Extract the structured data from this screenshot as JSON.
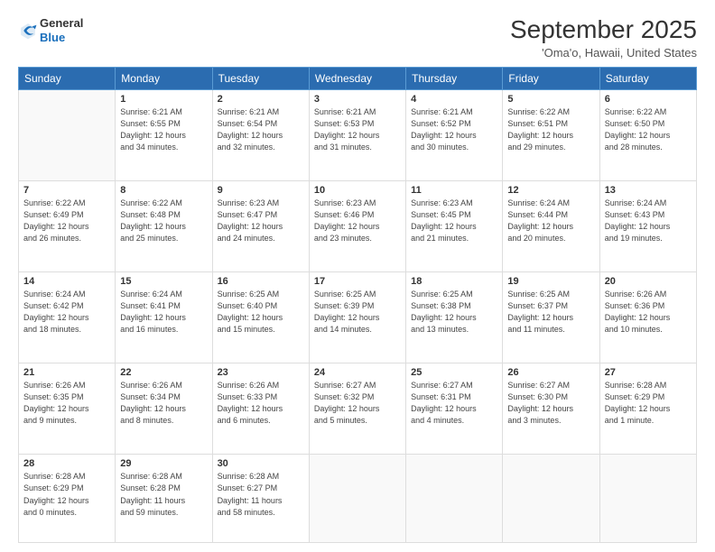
{
  "logo": {
    "general": "General",
    "blue": "Blue"
  },
  "header": {
    "month": "September 2025",
    "location": "'Oma'o, Hawaii, United States"
  },
  "weekdays": [
    "Sunday",
    "Monday",
    "Tuesday",
    "Wednesday",
    "Thursday",
    "Friday",
    "Saturday"
  ],
  "weeks": [
    [
      {
        "day": "",
        "info": ""
      },
      {
        "day": "1",
        "info": "Sunrise: 6:21 AM\nSunset: 6:55 PM\nDaylight: 12 hours\nand 34 minutes."
      },
      {
        "day": "2",
        "info": "Sunrise: 6:21 AM\nSunset: 6:54 PM\nDaylight: 12 hours\nand 32 minutes."
      },
      {
        "day": "3",
        "info": "Sunrise: 6:21 AM\nSunset: 6:53 PM\nDaylight: 12 hours\nand 31 minutes."
      },
      {
        "day": "4",
        "info": "Sunrise: 6:21 AM\nSunset: 6:52 PM\nDaylight: 12 hours\nand 30 minutes."
      },
      {
        "day": "5",
        "info": "Sunrise: 6:22 AM\nSunset: 6:51 PM\nDaylight: 12 hours\nand 29 minutes."
      },
      {
        "day": "6",
        "info": "Sunrise: 6:22 AM\nSunset: 6:50 PM\nDaylight: 12 hours\nand 28 minutes."
      }
    ],
    [
      {
        "day": "7",
        "info": "Sunrise: 6:22 AM\nSunset: 6:49 PM\nDaylight: 12 hours\nand 26 minutes."
      },
      {
        "day": "8",
        "info": "Sunrise: 6:22 AM\nSunset: 6:48 PM\nDaylight: 12 hours\nand 25 minutes."
      },
      {
        "day": "9",
        "info": "Sunrise: 6:23 AM\nSunset: 6:47 PM\nDaylight: 12 hours\nand 24 minutes."
      },
      {
        "day": "10",
        "info": "Sunrise: 6:23 AM\nSunset: 6:46 PM\nDaylight: 12 hours\nand 23 minutes."
      },
      {
        "day": "11",
        "info": "Sunrise: 6:23 AM\nSunset: 6:45 PM\nDaylight: 12 hours\nand 21 minutes."
      },
      {
        "day": "12",
        "info": "Sunrise: 6:24 AM\nSunset: 6:44 PM\nDaylight: 12 hours\nand 20 minutes."
      },
      {
        "day": "13",
        "info": "Sunrise: 6:24 AM\nSunset: 6:43 PM\nDaylight: 12 hours\nand 19 minutes."
      }
    ],
    [
      {
        "day": "14",
        "info": "Sunrise: 6:24 AM\nSunset: 6:42 PM\nDaylight: 12 hours\nand 18 minutes."
      },
      {
        "day": "15",
        "info": "Sunrise: 6:24 AM\nSunset: 6:41 PM\nDaylight: 12 hours\nand 16 minutes."
      },
      {
        "day": "16",
        "info": "Sunrise: 6:25 AM\nSunset: 6:40 PM\nDaylight: 12 hours\nand 15 minutes."
      },
      {
        "day": "17",
        "info": "Sunrise: 6:25 AM\nSunset: 6:39 PM\nDaylight: 12 hours\nand 14 minutes."
      },
      {
        "day": "18",
        "info": "Sunrise: 6:25 AM\nSunset: 6:38 PM\nDaylight: 12 hours\nand 13 minutes."
      },
      {
        "day": "19",
        "info": "Sunrise: 6:25 AM\nSunset: 6:37 PM\nDaylight: 12 hours\nand 11 minutes."
      },
      {
        "day": "20",
        "info": "Sunrise: 6:26 AM\nSunset: 6:36 PM\nDaylight: 12 hours\nand 10 minutes."
      }
    ],
    [
      {
        "day": "21",
        "info": "Sunrise: 6:26 AM\nSunset: 6:35 PM\nDaylight: 12 hours\nand 9 minutes."
      },
      {
        "day": "22",
        "info": "Sunrise: 6:26 AM\nSunset: 6:34 PM\nDaylight: 12 hours\nand 8 minutes."
      },
      {
        "day": "23",
        "info": "Sunrise: 6:26 AM\nSunset: 6:33 PM\nDaylight: 12 hours\nand 6 minutes."
      },
      {
        "day": "24",
        "info": "Sunrise: 6:27 AM\nSunset: 6:32 PM\nDaylight: 12 hours\nand 5 minutes."
      },
      {
        "day": "25",
        "info": "Sunrise: 6:27 AM\nSunset: 6:31 PM\nDaylight: 12 hours\nand 4 minutes."
      },
      {
        "day": "26",
        "info": "Sunrise: 6:27 AM\nSunset: 6:30 PM\nDaylight: 12 hours\nand 3 minutes."
      },
      {
        "day": "27",
        "info": "Sunrise: 6:28 AM\nSunset: 6:29 PM\nDaylight: 12 hours\nand 1 minute."
      }
    ],
    [
      {
        "day": "28",
        "info": "Sunrise: 6:28 AM\nSunset: 6:29 PM\nDaylight: 12 hours\nand 0 minutes."
      },
      {
        "day": "29",
        "info": "Sunrise: 6:28 AM\nSunset: 6:28 PM\nDaylight: 11 hours\nand 59 minutes."
      },
      {
        "day": "30",
        "info": "Sunrise: 6:28 AM\nSunset: 6:27 PM\nDaylight: 11 hours\nand 58 minutes."
      },
      {
        "day": "",
        "info": ""
      },
      {
        "day": "",
        "info": ""
      },
      {
        "day": "",
        "info": ""
      },
      {
        "day": "",
        "info": ""
      }
    ]
  ]
}
